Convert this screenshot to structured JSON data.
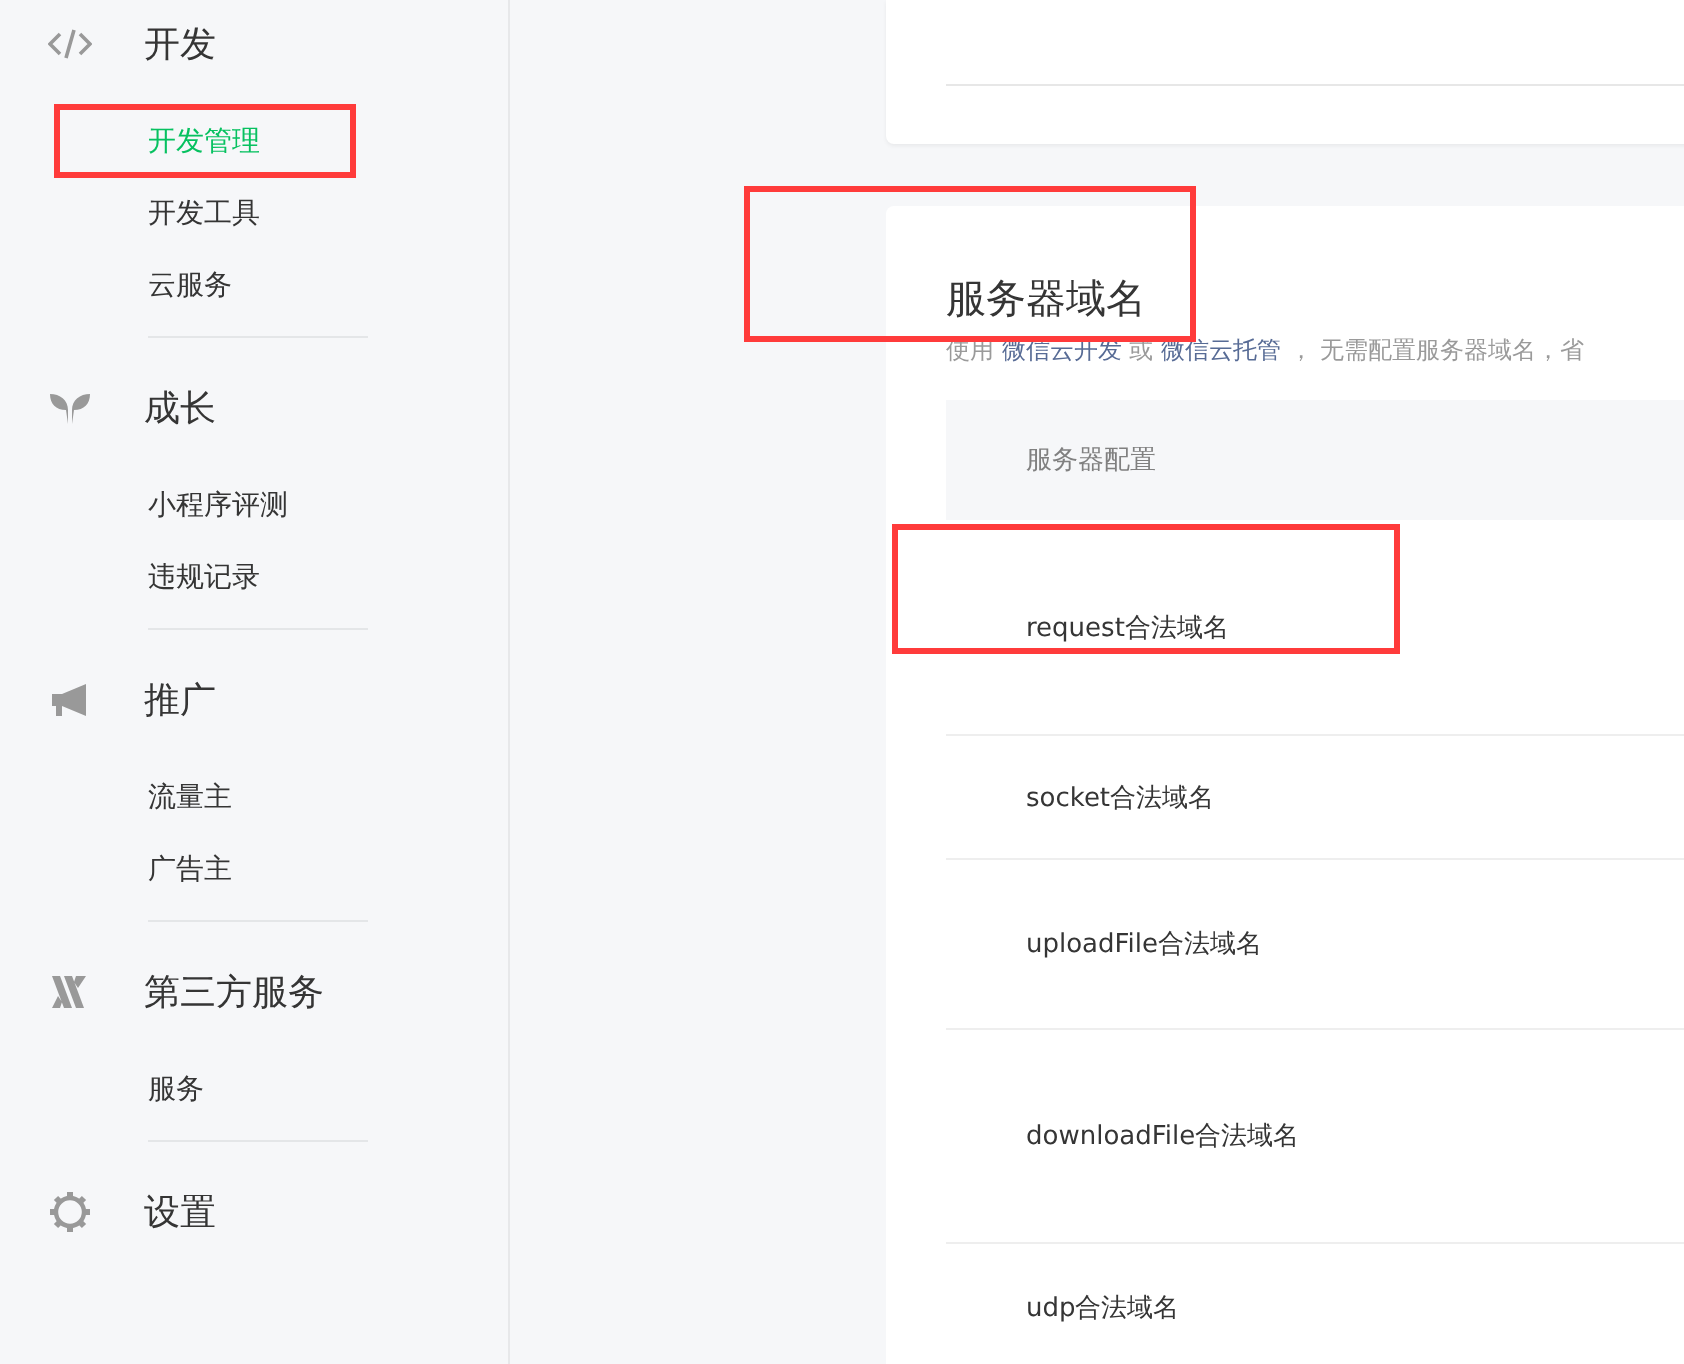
{
  "sidebar": {
    "sections": [
      {
        "label": "开发",
        "items": [
          {
            "label": "开发管理",
            "selected": true,
            "highlighted": true
          },
          {
            "label": "开发工具",
            "selected": false,
            "highlighted": false
          },
          {
            "label": "云服务",
            "selected": false,
            "highlighted": false
          }
        ]
      },
      {
        "label": "成长",
        "items": [
          {
            "label": "小程序评测",
            "selected": false,
            "highlighted": false
          },
          {
            "label": "违规记录",
            "selected": false,
            "highlighted": false
          }
        ]
      },
      {
        "label": "推广",
        "items": [
          {
            "label": "流量主",
            "selected": false,
            "highlighted": false
          },
          {
            "label": "广告主",
            "selected": false,
            "highlighted": false
          }
        ]
      },
      {
        "label": "第三方服务",
        "items": [
          {
            "label": "服务",
            "selected": false,
            "highlighted": false
          }
        ]
      },
      {
        "label": "设置"
      }
    ]
  },
  "server_domain": {
    "title": "服务器域名",
    "title_highlighted": true,
    "description": [
      {
        "kind": "text",
        "text": "使用 "
      },
      {
        "kind": "link",
        "text": "微信云开发"
      },
      {
        "kind": "text",
        "text": " 或 "
      },
      {
        "kind": "link",
        "text": "微信云托管"
      },
      {
        "kind": "text",
        "text": " ， 无需配置服务器域名，省"
      }
    ],
    "table_header": "服务器配置",
    "rows": [
      {
        "label": "request合法域名",
        "highlighted": true
      },
      {
        "label": "socket合法域名",
        "highlighted": false
      },
      {
        "label": "uploadFile合法域名",
        "highlighted": false
      },
      {
        "label": "downloadFile合法域名",
        "highlighted": false
      },
      {
        "label": "udp合法域名",
        "highlighted": false
      }
    ]
  }
}
